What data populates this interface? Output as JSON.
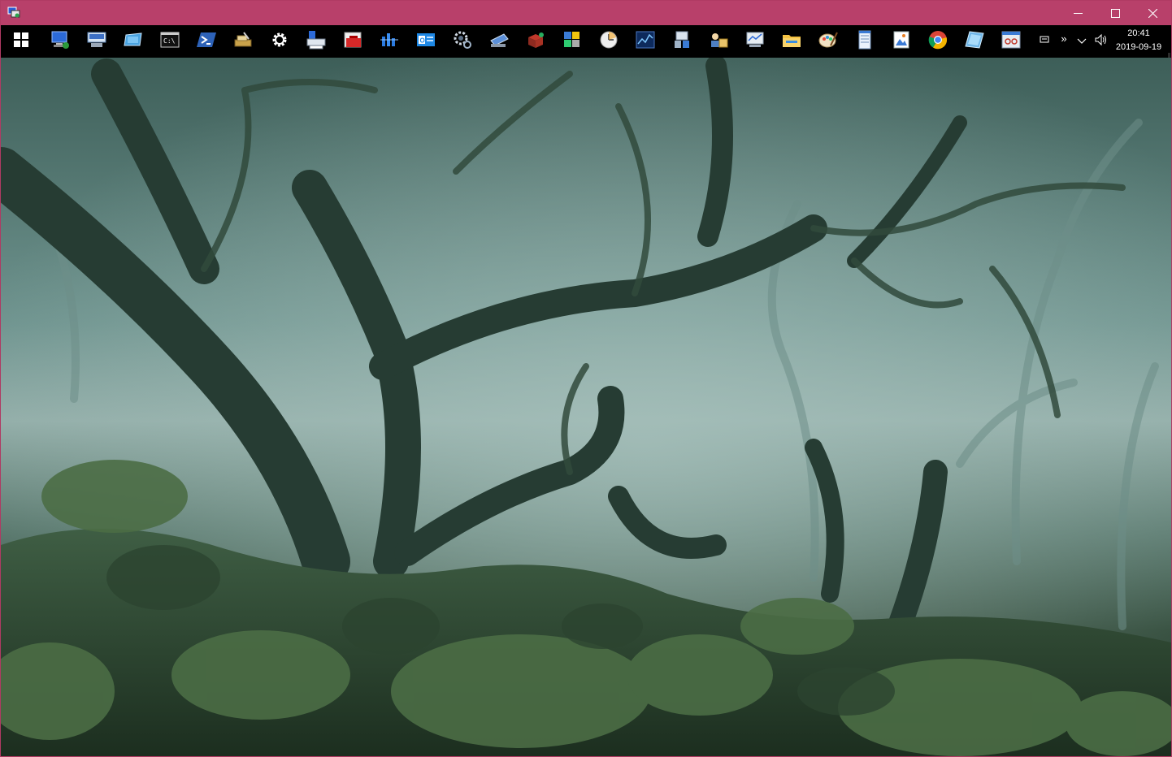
{
  "window": {
    "controls": {
      "minimize": "minimize-icon",
      "maximize": "maximize-icon",
      "close": "close-icon"
    },
    "accent": "#b8406a"
  },
  "taskbar": {
    "icons": [
      {
        "name": "start-windows-icon"
      },
      {
        "name": "computer-icon"
      },
      {
        "name": "remote-desktop-icon"
      },
      {
        "name": "window-icon"
      },
      {
        "name": "command-prompt-icon"
      },
      {
        "name": "powershell-icon"
      },
      {
        "name": "tools-icon"
      },
      {
        "name": "settings-gear-icon"
      },
      {
        "name": "printer-icon"
      },
      {
        "name": "toolbox-icon"
      },
      {
        "name": "network-icon"
      },
      {
        "name": "outlook-icon"
      },
      {
        "name": "services-gear-icon"
      },
      {
        "name": "scanner-icon"
      },
      {
        "name": "package-icon"
      },
      {
        "name": "registry-icon"
      },
      {
        "name": "clock-icon"
      },
      {
        "name": "performance-monitor-icon"
      },
      {
        "name": "device-manager-icon"
      },
      {
        "name": "user-accounts-icon"
      },
      {
        "name": "disk-management-icon"
      },
      {
        "name": "file-explorer-icon"
      },
      {
        "name": "paint-icon"
      },
      {
        "name": "notepad-icon"
      },
      {
        "name": "picture-viewer-icon"
      },
      {
        "name": "chrome-icon"
      },
      {
        "name": "tablet-icon"
      },
      {
        "name": "snipping-tool-icon"
      }
    ],
    "tray": {
      "show_hidden_label": "»",
      "icons": [
        "notification-icon",
        "chevron-up-icon",
        "volume-icon"
      ]
    },
    "clock": {
      "time": "20:41",
      "date": "2019-09-19"
    }
  }
}
